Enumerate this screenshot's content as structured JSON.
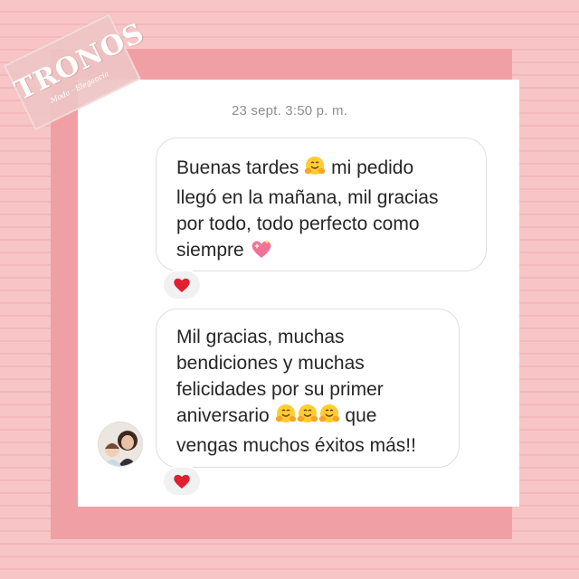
{
  "brand": {
    "watermark": "TRONOS",
    "watermark_sub": "Moda · Elegancia"
  },
  "conversation": {
    "timestamp": "23 sept. 3:50 p. m.",
    "messages": [
      {
        "text_before": "Buenas tardes ",
        "text_middle": " mi pedido\nllegó en la mañana, mil gracias\npor todo, todo perfecto como\nsiempre ",
        "emoji": [
          "hugging-face-icon",
          "sparkling-heart-icon"
        ],
        "reaction": "heart-icon"
      },
      {
        "text_before": "Mil gracias, muchas\nbendiciones y muchas\nfelicidades por su primer\naniversario ",
        "text_after": " que\nvengas muchos éxitos más!!",
        "emoji": [
          "hugging-face-icon",
          "hugging-face-icon",
          "hugging-face-icon"
        ],
        "reaction": "heart-icon"
      }
    ]
  },
  "colors": {
    "heart": "#e0202f",
    "frame": "#f0a0a4",
    "background": "#f7c5c6"
  }
}
